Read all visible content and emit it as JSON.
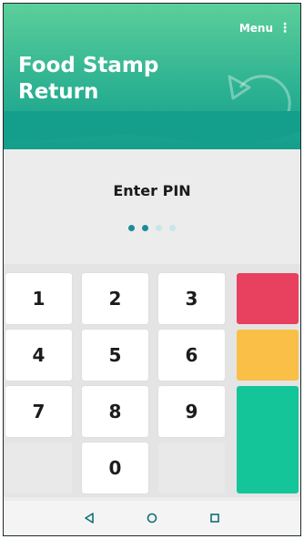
{
  "header": {
    "menu_label": "Menu",
    "menu_dots": "⋮",
    "title_line1": "Food Stamp",
    "title_line2": "Return"
  },
  "pin": {
    "label": "Enter PIN",
    "digits_entered": 2,
    "digits_total": 4
  },
  "keypad": {
    "keys": [
      "1",
      "2",
      "3",
      "4",
      "5",
      "6",
      "7",
      "8",
      "9",
      "0"
    ]
  },
  "colors": {
    "header_top": "#5ccf9a",
    "header_bottom": "#149e8c",
    "action_red": "#e8405f",
    "action_yellow": "#f9bf47",
    "action_green": "#14c59a",
    "pin_dot_filled": "#1a8c97",
    "pin_dot_empty": "#c8e6ea"
  },
  "navbar": {
    "icons": [
      "back-triangle-icon",
      "home-circle-icon",
      "recents-square-icon"
    ]
  }
}
